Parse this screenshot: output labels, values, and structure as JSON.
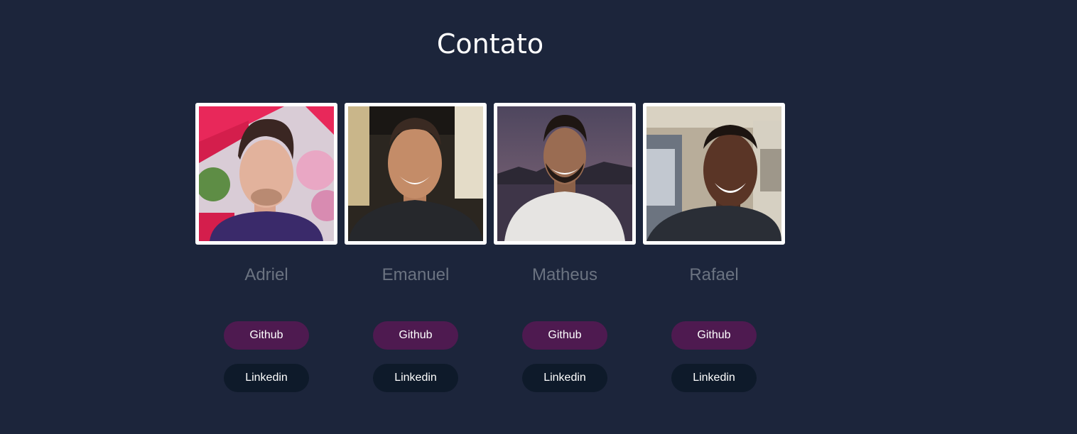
{
  "page": {
    "title": "Contato"
  },
  "members": [
    {
      "name": "Adriel",
      "github_label": "Github",
      "linkedin_label": "Linkedin"
    },
    {
      "name": "Emanuel",
      "github_label": "Github",
      "linkedin_label": "Linkedin"
    },
    {
      "name": "Matheus",
      "github_label": "Github",
      "linkedin_label": "Linkedin"
    },
    {
      "name": "Rafael",
      "github_label": "Github",
      "linkedin_label": "Linkedin"
    }
  ],
  "colors": {
    "background": "#1c253b",
    "github_button": "#4e1a50",
    "linkedin_button": "#0e1a2a",
    "name_text": "#6b7381"
  }
}
